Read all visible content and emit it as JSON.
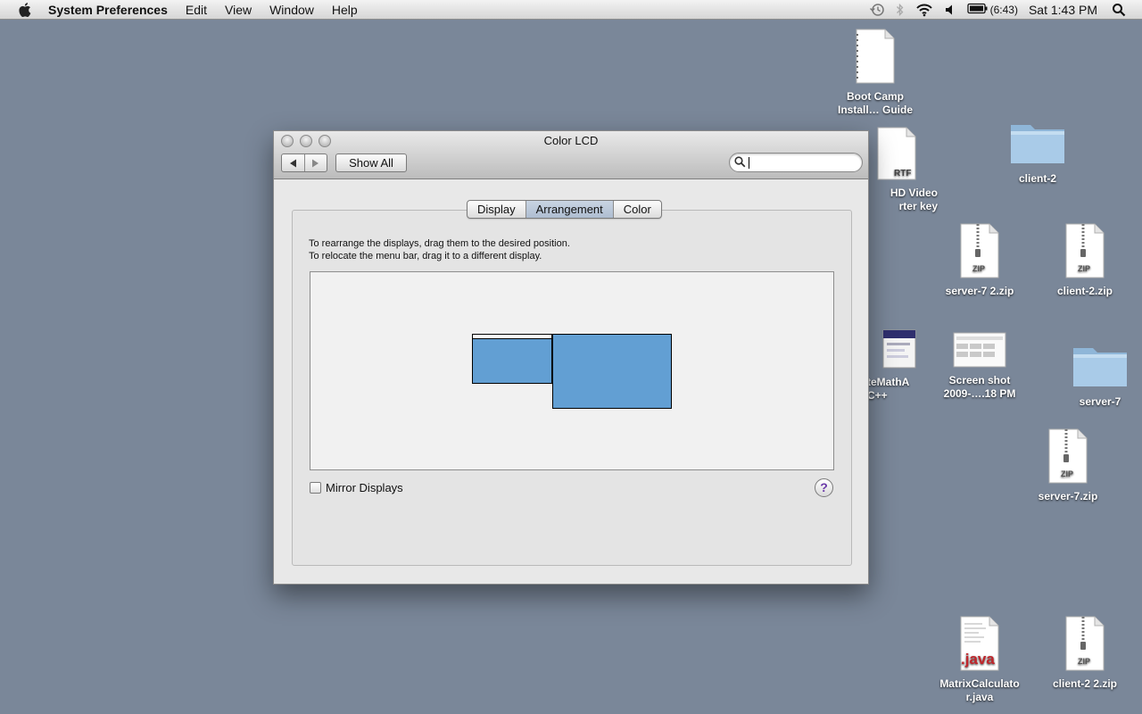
{
  "menubar": {
    "app_name": "System Preferences",
    "items": [
      "Edit",
      "View",
      "Window",
      "Help"
    ],
    "battery_time": "(6:43)",
    "clock": "Sat 1:43 PM"
  },
  "desktop": {
    "icons": [
      {
        "label": "Boot Camp\nInstall… Guide",
        "kind": "document"
      },
      {
        "label": "HD Video\nrter key",
        "kind": "rtf",
        "badge": "RTF"
      },
      {
        "label": "client-2",
        "kind": "folder"
      },
      {
        "label": "server-7 2.zip",
        "kind": "zip",
        "badge": "ZIP"
      },
      {
        "label": "client-2.zip",
        "kind": "zip",
        "badge": "ZIP"
      },
      {
        "label": "teMathA\nC++",
        "kind": "screenshot"
      },
      {
        "label": "Screen shot\n2009-….18 PM",
        "kind": "screenshot"
      },
      {
        "label": "server-7",
        "kind": "folder"
      },
      {
        "label": "server-7.zip",
        "kind": "zip",
        "badge": "ZIP"
      },
      {
        "label": "MatrixCalculato\nr.java",
        "kind": "java",
        "badge": ".java"
      },
      {
        "label": "client-2 2.zip",
        "kind": "zip",
        "badge": "ZIP"
      }
    ]
  },
  "window": {
    "title": "Color LCD",
    "show_all": "Show All",
    "search": {
      "value": "",
      "placeholder": ""
    },
    "tabs": [
      "Display",
      "Arrangement",
      "Color"
    ],
    "active_tab": "Arrangement",
    "instructions": [
      "To rearrange the displays, drag them to the desired position.",
      "To relocate the menu bar, drag it to a different display."
    ],
    "mirror_displays": {
      "label": "Mirror Displays",
      "checked": false
    },
    "help": "?",
    "display_color": "#629fd3"
  }
}
